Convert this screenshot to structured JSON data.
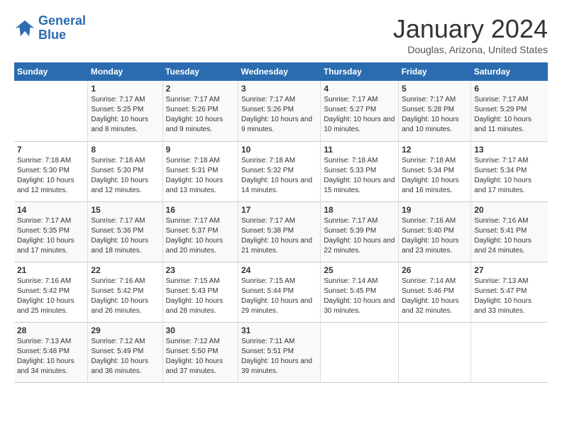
{
  "logo": {
    "line1": "General",
    "line2": "Blue"
  },
  "title": "January 2024",
  "location": "Douglas, Arizona, United States",
  "days_of_week": [
    "Sunday",
    "Monday",
    "Tuesday",
    "Wednesday",
    "Thursday",
    "Friday",
    "Saturday"
  ],
  "weeks": [
    [
      {
        "num": "",
        "sunrise": "",
        "sunset": "",
        "daylight": ""
      },
      {
        "num": "1",
        "sunrise": "Sunrise: 7:17 AM",
        "sunset": "Sunset: 5:25 PM",
        "daylight": "Daylight: 10 hours and 8 minutes."
      },
      {
        "num": "2",
        "sunrise": "Sunrise: 7:17 AM",
        "sunset": "Sunset: 5:26 PM",
        "daylight": "Daylight: 10 hours and 9 minutes."
      },
      {
        "num": "3",
        "sunrise": "Sunrise: 7:17 AM",
        "sunset": "Sunset: 5:26 PM",
        "daylight": "Daylight: 10 hours and 9 minutes."
      },
      {
        "num": "4",
        "sunrise": "Sunrise: 7:17 AM",
        "sunset": "Sunset: 5:27 PM",
        "daylight": "Daylight: 10 hours and 10 minutes."
      },
      {
        "num": "5",
        "sunrise": "Sunrise: 7:17 AM",
        "sunset": "Sunset: 5:28 PM",
        "daylight": "Daylight: 10 hours and 10 minutes."
      },
      {
        "num": "6",
        "sunrise": "Sunrise: 7:17 AM",
        "sunset": "Sunset: 5:29 PM",
        "daylight": "Daylight: 10 hours and 11 minutes."
      }
    ],
    [
      {
        "num": "7",
        "sunrise": "Sunrise: 7:18 AM",
        "sunset": "Sunset: 5:30 PM",
        "daylight": "Daylight: 10 hours and 12 minutes."
      },
      {
        "num": "8",
        "sunrise": "Sunrise: 7:18 AM",
        "sunset": "Sunset: 5:30 PM",
        "daylight": "Daylight: 10 hours and 12 minutes."
      },
      {
        "num": "9",
        "sunrise": "Sunrise: 7:18 AM",
        "sunset": "Sunset: 5:31 PM",
        "daylight": "Daylight: 10 hours and 13 minutes."
      },
      {
        "num": "10",
        "sunrise": "Sunrise: 7:18 AM",
        "sunset": "Sunset: 5:32 PM",
        "daylight": "Daylight: 10 hours and 14 minutes."
      },
      {
        "num": "11",
        "sunrise": "Sunrise: 7:18 AM",
        "sunset": "Sunset: 5:33 PM",
        "daylight": "Daylight: 10 hours and 15 minutes."
      },
      {
        "num": "12",
        "sunrise": "Sunrise: 7:18 AM",
        "sunset": "Sunset: 5:34 PM",
        "daylight": "Daylight: 10 hours and 16 minutes."
      },
      {
        "num": "13",
        "sunrise": "Sunrise: 7:17 AM",
        "sunset": "Sunset: 5:34 PM",
        "daylight": "Daylight: 10 hours and 17 minutes."
      }
    ],
    [
      {
        "num": "14",
        "sunrise": "Sunrise: 7:17 AM",
        "sunset": "Sunset: 5:35 PM",
        "daylight": "Daylight: 10 hours and 17 minutes."
      },
      {
        "num": "15",
        "sunrise": "Sunrise: 7:17 AM",
        "sunset": "Sunset: 5:36 PM",
        "daylight": "Daylight: 10 hours and 18 minutes."
      },
      {
        "num": "16",
        "sunrise": "Sunrise: 7:17 AM",
        "sunset": "Sunset: 5:37 PM",
        "daylight": "Daylight: 10 hours and 20 minutes."
      },
      {
        "num": "17",
        "sunrise": "Sunrise: 7:17 AM",
        "sunset": "Sunset: 5:38 PM",
        "daylight": "Daylight: 10 hours and 21 minutes."
      },
      {
        "num": "18",
        "sunrise": "Sunrise: 7:17 AM",
        "sunset": "Sunset: 5:39 PM",
        "daylight": "Daylight: 10 hours and 22 minutes."
      },
      {
        "num": "19",
        "sunrise": "Sunrise: 7:16 AM",
        "sunset": "Sunset: 5:40 PM",
        "daylight": "Daylight: 10 hours and 23 minutes."
      },
      {
        "num": "20",
        "sunrise": "Sunrise: 7:16 AM",
        "sunset": "Sunset: 5:41 PM",
        "daylight": "Daylight: 10 hours and 24 minutes."
      }
    ],
    [
      {
        "num": "21",
        "sunrise": "Sunrise: 7:16 AM",
        "sunset": "Sunset: 5:42 PM",
        "daylight": "Daylight: 10 hours and 25 minutes."
      },
      {
        "num": "22",
        "sunrise": "Sunrise: 7:16 AM",
        "sunset": "Sunset: 5:42 PM",
        "daylight": "Daylight: 10 hours and 26 minutes."
      },
      {
        "num": "23",
        "sunrise": "Sunrise: 7:15 AM",
        "sunset": "Sunset: 5:43 PM",
        "daylight": "Daylight: 10 hours and 28 minutes."
      },
      {
        "num": "24",
        "sunrise": "Sunrise: 7:15 AM",
        "sunset": "Sunset: 5:44 PM",
        "daylight": "Daylight: 10 hours and 29 minutes."
      },
      {
        "num": "25",
        "sunrise": "Sunrise: 7:14 AM",
        "sunset": "Sunset: 5:45 PM",
        "daylight": "Daylight: 10 hours and 30 minutes."
      },
      {
        "num": "26",
        "sunrise": "Sunrise: 7:14 AM",
        "sunset": "Sunset: 5:46 PM",
        "daylight": "Daylight: 10 hours and 32 minutes."
      },
      {
        "num": "27",
        "sunrise": "Sunrise: 7:13 AM",
        "sunset": "Sunset: 5:47 PM",
        "daylight": "Daylight: 10 hours and 33 minutes."
      }
    ],
    [
      {
        "num": "28",
        "sunrise": "Sunrise: 7:13 AM",
        "sunset": "Sunset: 5:48 PM",
        "daylight": "Daylight: 10 hours and 34 minutes."
      },
      {
        "num": "29",
        "sunrise": "Sunrise: 7:12 AM",
        "sunset": "Sunset: 5:49 PM",
        "daylight": "Daylight: 10 hours and 36 minutes."
      },
      {
        "num": "30",
        "sunrise": "Sunrise: 7:12 AM",
        "sunset": "Sunset: 5:50 PM",
        "daylight": "Daylight: 10 hours and 37 minutes."
      },
      {
        "num": "31",
        "sunrise": "Sunrise: 7:11 AM",
        "sunset": "Sunset: 5:51 PM",
        "daylight": "Daylight: 10 hours and 39 minutes."
      },
      {
        "num": "",
        "sunrise": "",
        "sunset": "",
        "daylight": ""
      },
      {
        "num": "",
        "sunrise": "",
        "sunset": "",
        "daylight": ""
      },
      {
        "num": "",
        "sunrise": "",
        "sunset": "",
        "daylight": ""
      }
    ]
  ]
}
